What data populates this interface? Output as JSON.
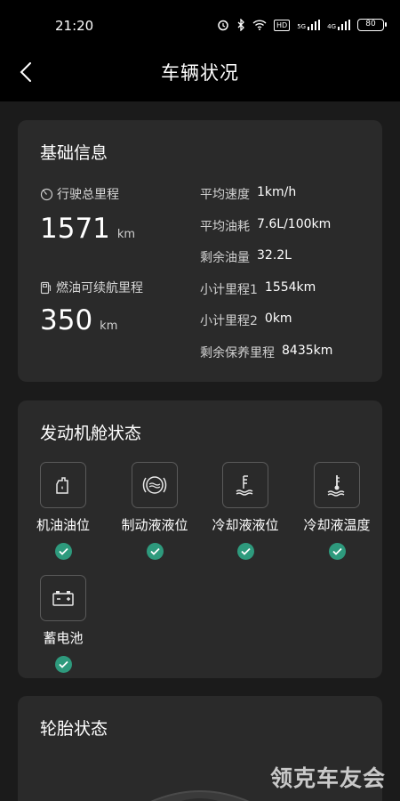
{
  "status_bar": {
    "time": "21:20",
    "hd_label": "HD",
    "net1": "5G",
    "net2": "4G",
    "battery": "80",
    "icons": [
      "alarm-icon",
      "bluetooth-icon",
      "wifi-icon",
      "signal-icon"
    ]
  },
  "header": {
    "title": "车辆状况",
    "back_icon": "chevron-left-icon"
  },
  "basic_info": {
    "title": "基础信息",
    "total_mileage": {
      "label": "行驶总里程",
      "value": "1571",
      "unit": "km",
      "icon": "gauge-icon"
    },
    "fuel_range": {
      "label": "燃油可续航里程",
      "value": "350",
      "unit": "km",
      "icon": "fuel-pump-icon"
    },
    "stats": [
      {
        "label": "平均速度",
        "value": "1km/h"
      },
      {
        "label": "平均油耗",
        "value": "7.6L/100km"
      },
      {
        "label": "剩余油量",
        "value": "32.2L"
      },
      {
        "label": "小计里程1",
        "value": "1554km"
      },
      {
        "label": "小计里程2",
        "value": "0km"
      },
      {
        "label": "剩余保养里程",
        "value": "8435km"
      }
    ]
  },
  "engine_status": {
    "title": "发动机舱状态",
    "items": [
      {
        "label": "机油油位",
        "icon": "oil-can-icon",
        "status": "ok"
      },
      {
        "label": "制动液液位",
        "icon": "brake-fluid-icon",
        "status": "ok"
      },
      {
        "label": "冷却液液位",
        "icon": "coolant-level-icon",
        "status": "ok"
      },
      {
        "label": "冷却液温度",
        "icon": "coolant-temperature-icon",
        "status": "ok"
      },
      {
        "label": "蓄电池",
        "icon": "battery-icon",
        "status": "ok"
      }
    ]
  },
  "tire_status": {
    "title": "轮胎状态"
  },
  "watermark": "领克车友会",
  "colors": {
    "background": "#1b1b1b",
    "card": "#2a2a2a",
    "ok_green": "#2e9a7d",
    "bar": "#000000"
  }
}
